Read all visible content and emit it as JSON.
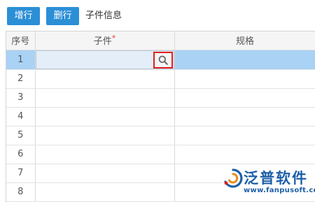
{
  "toolbar": {
    "add_row_label": "增行",
    "delete_row_label": "删行",
    "section_title": "子件信息"
  },
  "table": {
    "columns": [
      {
        "label": "序号"
      },
      {
        "label": "子件",
        "required_mark": "*"
      },
      {
        "label": "规格"
      }
    ],
    "rows": [
      {
        "no": "1",
        "selected": true
      },
      {
        "no": "2"
      },
      {
        "no": "3"
      },
      {
        "no": "4"
      },
      {
        "no": "5"
      },
      {
        "no": "6"
      },
      {
        "no": "7"
      },
      {
        "no": "8"
      }
    ]
  },
  "icons": {
    "lookup": "search-icon"
  },
  "watermark": {
    "brand": "泛普软件",
    "url": "www.fanpusoft.com"
  },
  "colors": {
    "button": "#2b8fd6",
    "selected_row": "#a9d2f5",
    "highlight_border": "#e02020",
    "brand": "#1d5fa8"
  }
}
